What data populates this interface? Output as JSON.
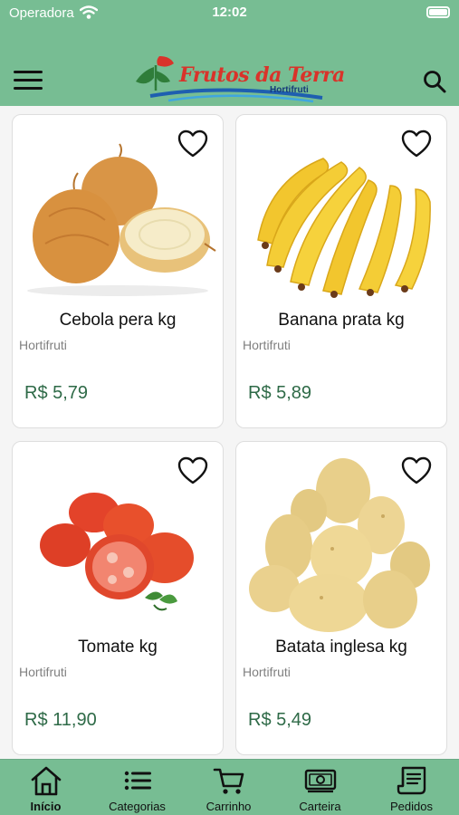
{
  "status_bar": {
    "carrier": "Operadora",
    "time": "12:02"
  },
  "header": {
    "logo_title": "Frutos da Terra",
    "logo_subtitle": "Hortifruti",
    "menu_icon": "hamburger-menu-icon",
    "search_icon": "search-icon"
  },
  "products": [
    {
      "name": "Cebola pera kg",
      "category": "Hortifruti",
      "price": "R$ 5,79",
      "image": "onion-image"
    },
    {
      "name": "Banana prata kg",
      "category": "Hortifruti",
      "price": "R$ 5,89",
      "image": "banana-image"
    },
    {
      "name": "Tomate kg",
      "category": "Hortifruti",
      "price": "R$ 11,90",
      "image": "tomato-image"
    },
    {
      "name": "Batata inglesa kg",
      "category": "Hortifruti",
      "price": "R$ 5,49",
      "image": "potato-image"
    }
  ],
  "tabbar": {
    "active": "Início",
    "tabs": [
      {
        "label": "Início",
        "icon": "home-icon"
      },
      {
        "label": "Categorias",
        "icon": "list-icon"
      },
      {
        "label": "Carrinho",
        "icon": "cart-icon"
      },
      {
        "label": "Carteira",
        "icon": "wallet-icon"
      },
      {
        "label": "Pedidos",
        "icon": "receipt-icon"
      }
    ]
  },
  "colors": {
    "brand_green": "#77bd93",
    "price_green": "#2e6a47",
    "logo_red": "#d9332a"
  }
}
